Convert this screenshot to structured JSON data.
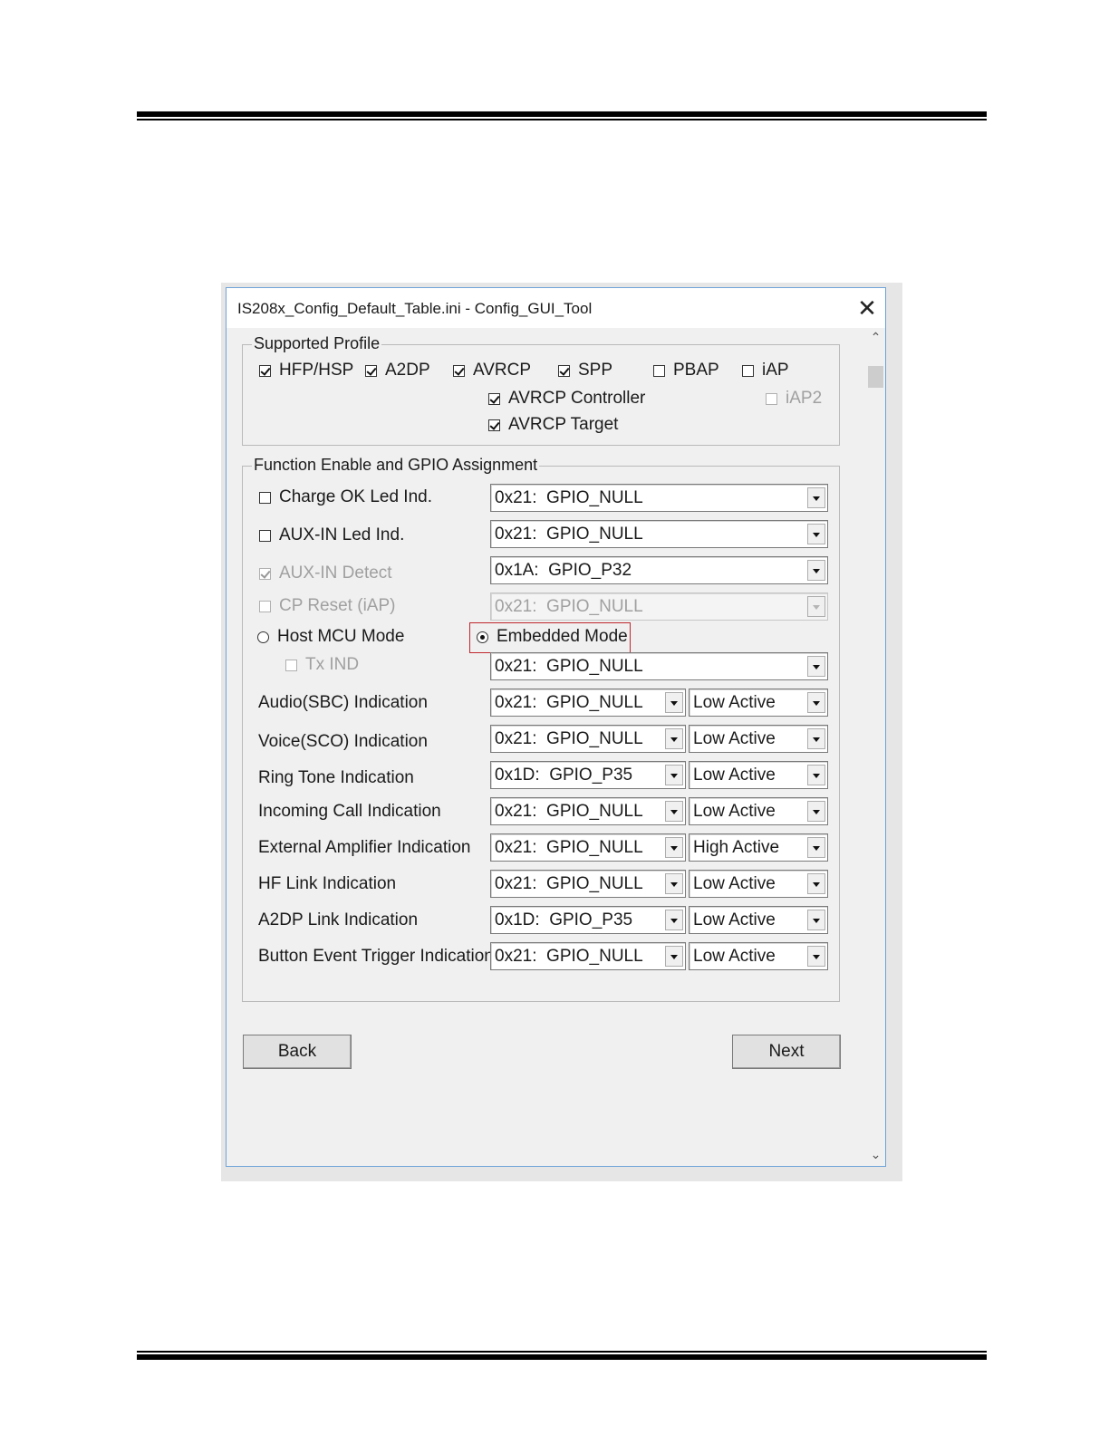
{
  "window": {
    "title": "IS208x_Config_Default_Table.ini - Config_GUI_Tool",
    "close": "✕"
  },
  "scroll": {
    "up": "⌃",
    "down": "⌄"
  },
  "supported_profile": {
    "title": "Supported Profile",
    "items": [
      {
        "label": "HFP/HSP",
        "checked": true
      },
      {
        "label": "A2DP",
        "checked": true
      },
      {
        "label": "AVRCP",
        "checked": true
      },
      {
        "label": "SPP",
        "checked": true
      },
      {
        "label": "PBAP",
        "checked": false
      },
      {
        "label": "iAP",
        "checked": false
      },
      {
        "label": "AVRCP Controller",
        "checked": true
      },
      {
        "label": "iAP2",
        "checked": false,
        "disabled": true
      },
      {
        "label": "AVRCP Target",
        "checked": true
      }
    ]
  },
  "function_group": {
    "title": "Function Enable and GPIO Assignment",
    "charge_ok": {
      "label": "Charge OK Led Ind.",
      "checked": false,
      "value": "0x21:  GPIO_NULL"
    },
    "aux_in_led": {
      "label": "AUX-IN Led Ind.",
      "checked": false,
      "value": "0x21:  GPIO_NULL"
    },
    "aux_in_detect": {
      "label": "AUX-IN Detect",
      "checked": true,
      "disabled": true,
      "value": "0x1A:  GPIO_P32"
    },
    "cp_reset": {
      "label": "CP Reset (iAP)",
      "checked": false,
      "disabled": true,
      "value": "0x21:  GPIO_NULL"
    },
    "host_mcu_mode": {
      "label": "Host MCU Mode",
      "selected": false
    },
    "embedded_mode": {
      "label": "Embedded Mode",
      "selected": true
    },
    "tx_ind": {
      "label": "Tx IND",
      "checked": false,
      "disabled": true,
      "value": "0x21:  GPIO_NULL"
    },
    "indications": [
      {
        "label": "Audio(SBC) Indication",
        "gpio": "0x21:  GPIO_NULL",
        "level": "Low Active"
      },
      {
        "label": "Voice(SCO) Indication",
        "gpio": "0x21:  GPIO_NULL",
        "level": "Low Active"
      },
      {
        "label": "Ring Tone Indication",
        "gpio": "0x1D:  GPIO_P35",
        "level": "Low Active"
      },
      {
        "label": "Incoming Call Indication",
        "gpio": "0x21:  GPIO_NULL",
        "level": "Low Active"
      },
      {
        "label": "External Amplifier Indication",
        "gpio": "0x21:  GPIO_NULL",
        "level": "High Active"
      },
      {
        "label": "HF Link Indication",
        "gpio": "0x21:  GPIO_NULL",
        "level": "Low Active"
      },
      {
        "label": "A2DP Link Indication",
        "gpio": "0x1D:  GPIO_P35",
        "level": "Low Active"
      },
      {
        "label": "Button Event Trigger Indication",
        "gpio": "0x21:  GPIO_NULL",
        "level": "Low Active"
      }
    ]
  },
  "buttons": {
    "back": "Back",
    "next": "Next"
  }
}
